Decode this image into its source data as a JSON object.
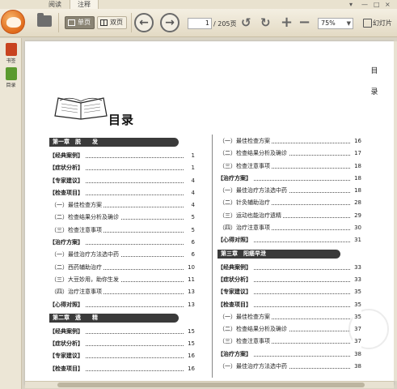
{
  "tabs": [
    {
      "label": "阅读"
    },
    {
      "label": "注释"
    }
  ],
  "window_controls": {
    "menu": "▾",
    "minimize": "—",
    "maximize": "□",
    "close": "×"
  },
  "toolbar": {
    "single_page_label": "单页",
    "double_page_label": "双页",
    "current_page": "1",
    "total_pages": "/ 205页",
    "zoom": "75%",
    "slideshow_label": "幻灯片"
  },
  "sidebar": {
    "bookmark_label": "书签",
    "toc_label": "目录"
  },
  "page": {
    "vertical_chars": [
      "目",
      "录"
    ],
    "title": "目录",
    "left_column": [
      {
        "type": "chapter",
        "text": "第一章　脱　　发",
        "width": "wide"
      },
      {
        "type": "bold",
        "text": "【经典案例】",
        "page": "1"
      },
      {
        "type": "bold",
        "text": "【症状分析】",
        "page": "1"
      },
      {
        "type": "bold",
        "text": "【专家建议】",
        "page": "4"
      },
      {
        "type": "bold",
        "text": "【检查项目】",
        "page": "4"
      },
      {
        "type": "sub",
        "text": "（一）最佳检查方案",
        "page": "4"
      },
      {
        "type": "sub",
        "text": "（二）检查结果分析及确诊",
        "page": "5"
      },
      {
        "type": "sub",
        "text": "（三）检查注意事项",
        "page": "5"
      },
      {
        "type": "bold",
        "text": "【治疗方案】",
        "page": "6"
      },
      {
        "type": "sub",
        "text": "（一）最佳治疗方法选中药",
        "page": "6"
      },
      {
        "type": "sub",
        "text": "（二）西药辅助治疗",
        "page": "10"
      },
      {
        "type": "sub",
        "text": "（三）大豆妙用，助你生发",
        "page": "11"
      },
      {
        "type": "sub",
        "text": "（四）治疗注意事项",
        "page": "13"
      },
      {
        "type": "bold",
        "text": "【心得对照】",
        "page": "13"
      },
      {
        "type": "chapter",
        "text": "第二章　遗　　精",
        "width": "wide"
      },
      {
        "type": "bold",
        "text": "【经典案例】",
        "page": "15"
      },
      {
        "type": "bold",
        "text": "【症状分析】",
        "page": "15"
      },
      {
        "type": "bold",
        "text": "【专家建议】",
        "page": "16"
      },
      {
        "type": "bold",
        "text": "【检查项目】",
        "page": "16"
      }
    ],
    "right_column": [
      {
        "type": "sub",
        "text": "（一）最佳检查方案",
        "page": "16"
      },
      {
        "type": "sub",
        "text": "（二）检查结果分析及确诊",
        "page": "17"
      },
      {
        "type": "sub",
        "text": "（三）检查注意事项",
        "page": "18"
      },
      {
        "type": "bold",
        "text": "【治疗方案】",
        "page": "18"
      },
      {
        "type": "sub",
        "text": "（一）最佳治疗方法选中药",
        "page": "18"
      },
      {
        "type": "sub",
        "text": "（二）针灸辅助治疗",
        "page": "28"
      },
      {
        "type": "sub",
        "text": "（三）运动也能治疗遗精",
        "page": "29"
      },
      {
        "type": "sub",
        "text": "（四）治疗注意事项",
        "page": "30"
      },
      {
        "type": "bold",
        "text": "【心得对照】",
        "page": "31"
      },
      {
        "type": "chapter",
        "text": "第三章　阳痿早泄",
        "width": "mid"
      },
      {
        "type": "bold",
        "text": "【经典案例】",
        "page": "33"
      },
      {
        "type": "bold",
        "text": "【症状分析】",
        "page": "33"
      },
      {
        "type": "bold",
        "text": "【专家建议】",
        "page": "35"
      },
      {
        "type": "bold",
        "text": "【检查项目】",
        "page": "35"
      },
      {
        "type": "sub",
        "text": "（一）最佳检查方案",
        "page": "35"
      },
      {
        "type": "sub",
        "text": "（二）检查结果分析及确诊",
        "page": "37"
      },
      {
        "type": "sub",
        "text": "（三）检查注意事项",
        "page": "37"
      },
      {
        "type": "bold",
        "text": "【治疗方案】",
        "page": "38"
      },
      {
        "type": "sub",
        "text": "（一）最佳治疗方法选中药",
        "page": "38"
      }
    ]
  }
}
